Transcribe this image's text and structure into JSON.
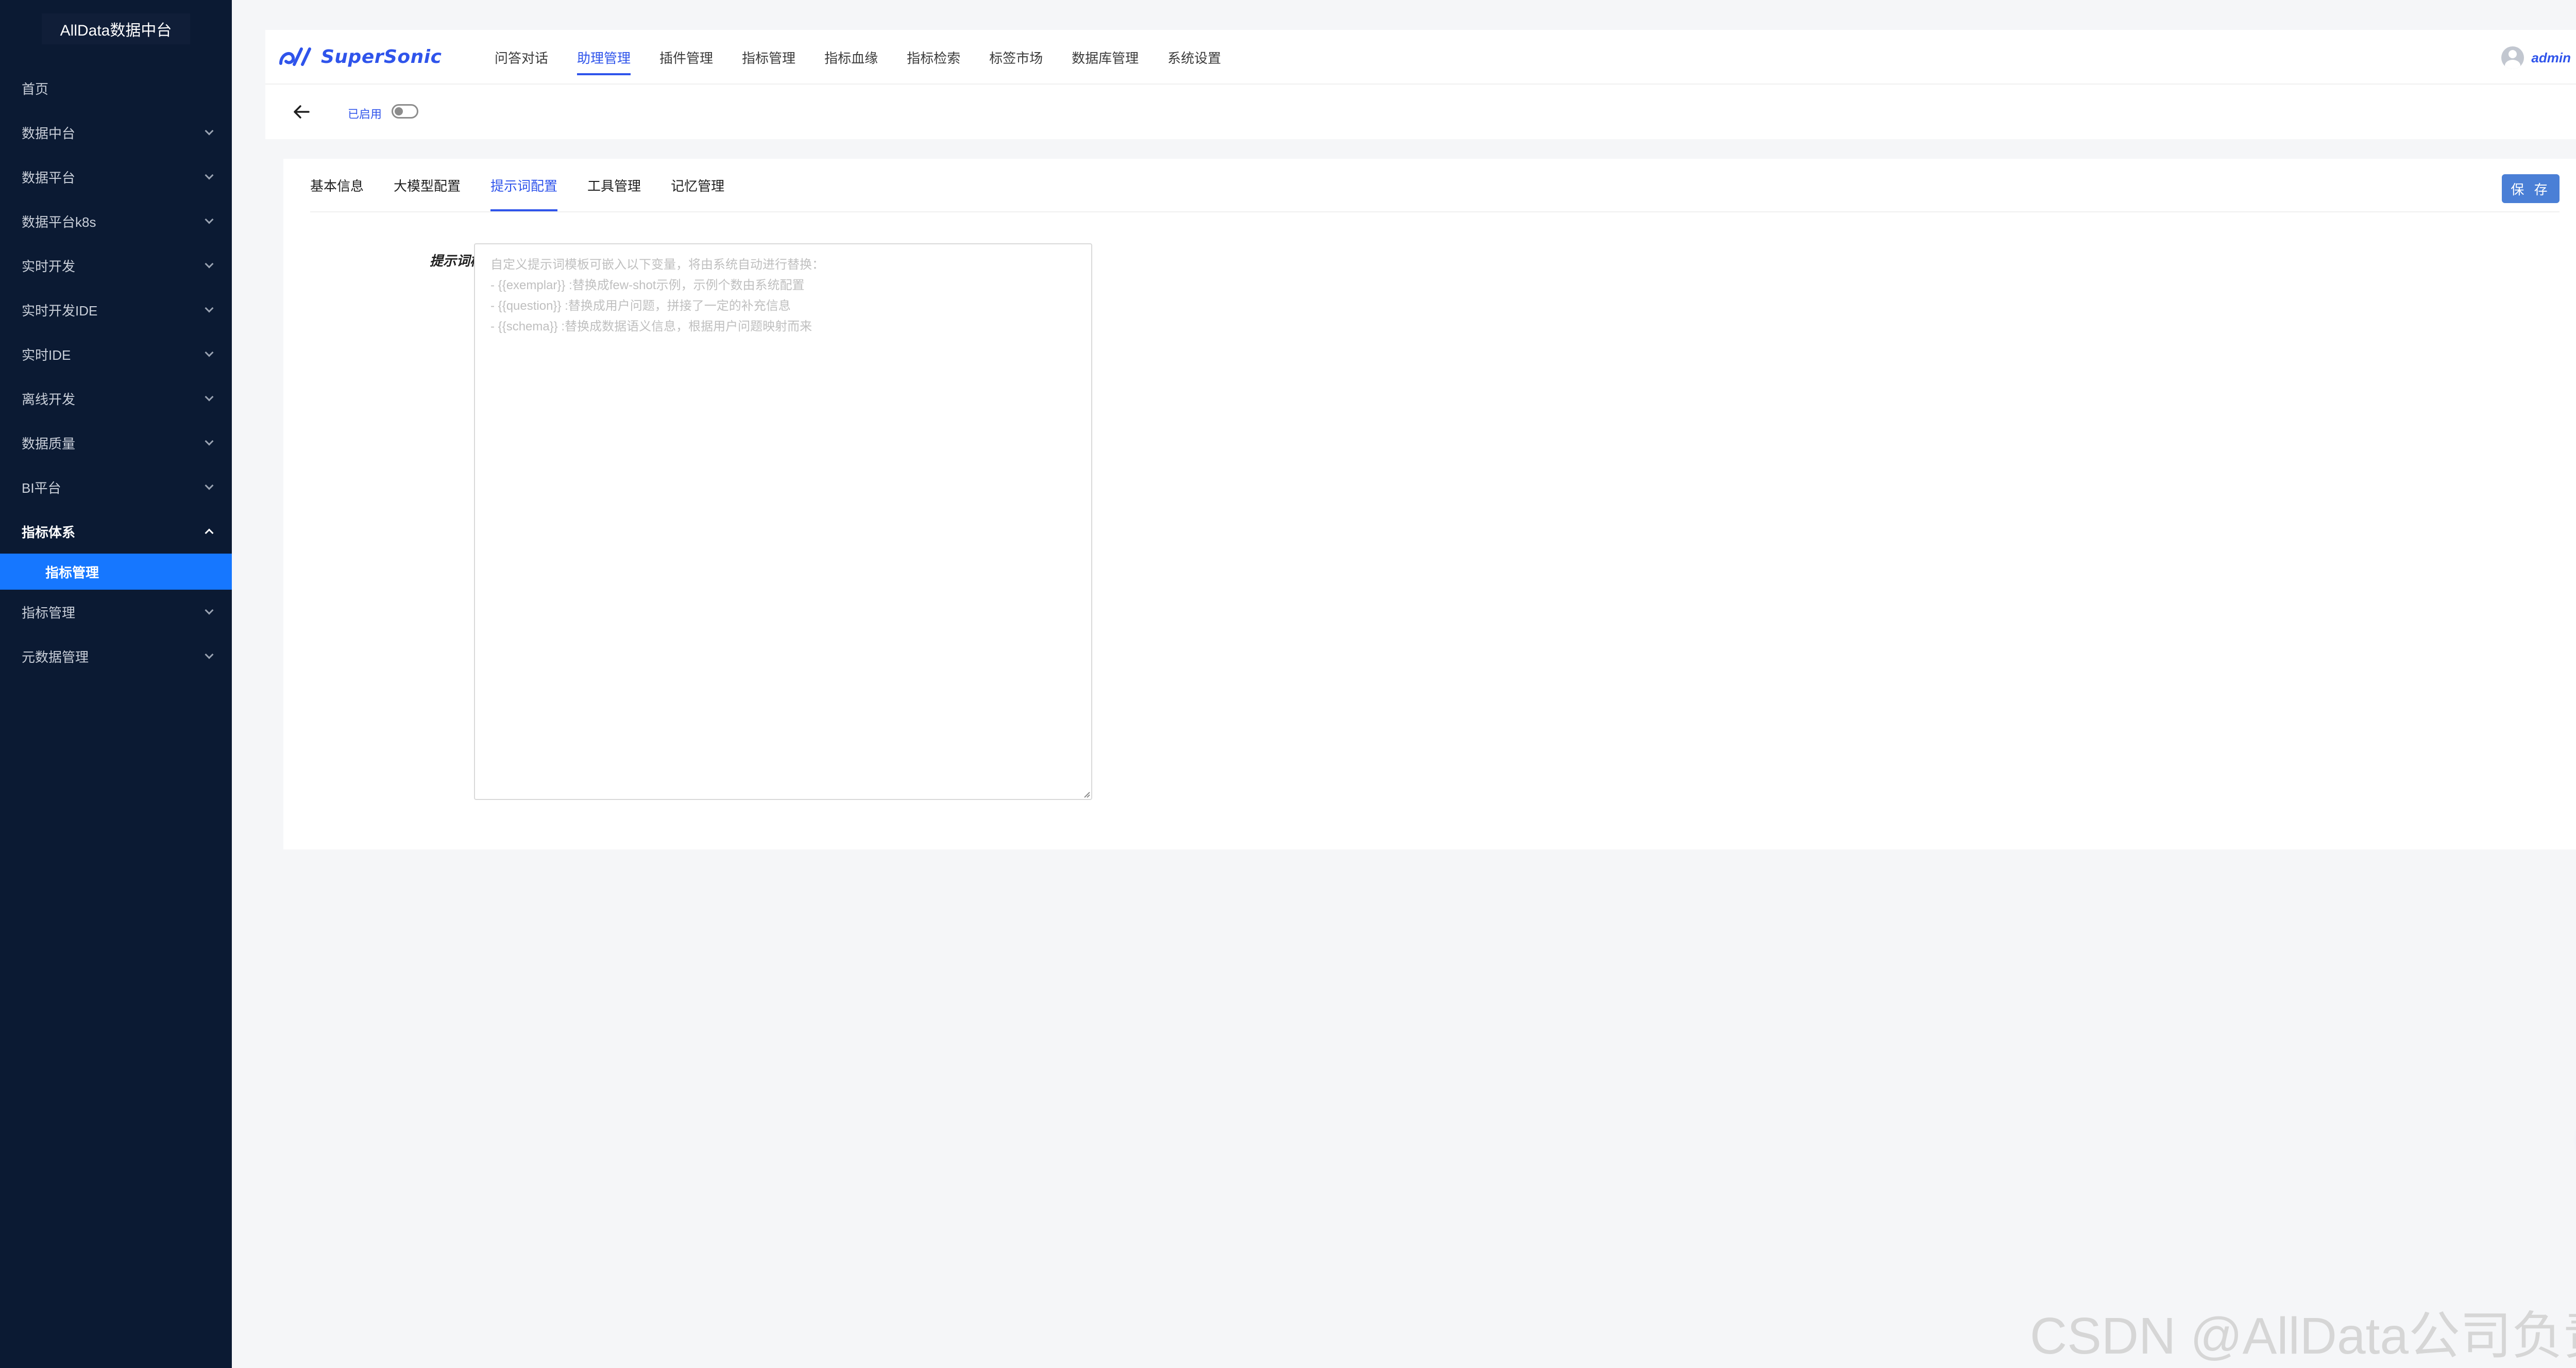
{
  "sidebar": {
    "brand": "AllData数据中台",
    "items": [
      {
        "label": "首页",
        "has_arrow": false
      },
      {
        "label": "数据中台",
        "has_arrow": true
      },
      {
        "label": "数据平台",
        "has_arrow": true
      },
      {
        "label": "数据平台k8s",
        "has_arrow": true
      },
      {
        "label": "实时开发",
        "has_arrow": true
      },
      {
        "label": "实时开发IDE",
        "has_arrow": true
      },
      {
        "label": "实时IDE",
        "has_arrow": true
      },
      {
        "label": "离线开发",
        "has_arrow": true
      },
      {
        "label": "数据质量",
        "has_arrow": true
      },
      {
        "label": "BI平台",
        "has_arrow": true
      },
      {
        "label": "指标体系",
        "has_arrow": true,
        "open": true
      },
      {
        "label": "指标管理",
        "has_arrow": true
      },
      {
        "label": "元数据管理",
        "has_arrow": true
      }
    ],
    "active_subitem": "指标管理"
  },
  "topnav": {
    "logo_text": "SuperSonic",
    "tabs": [
      "问答对话",
      "助理管理",
      "插件管理",
      "指标管理",
      "指标血缘",
      "指标检索",
      "标签市场",
      "数据库管理",
      "系统设置"
    ],
    "active_tab": "助理管理",
    "user": "admin"
  },
  "subheader": {
    "status_label": "已启用",
    "enabled": false
  },
  "card": {
    "tabs": [
      "基本信息",
      "大模型配置",
      "提示词配置",
      "工具管理",
      "记忆管理"
    ],
    "active_tab": "提示词配置",
    "save_label": "保 存",
    "form": {
      "label": "提示词模板：",
      "placeholder_lines": [
        "自定义提示词模板可嵌入以下变量，将由系统自动进行替换：",
        "- {{exemplar}} :替换成few-shot示例，示例个数由系统配置",
        "- {{question}} :替换成用户问题，拼接了一定的补充信息",
        "- {{schema}} :替换成数据语义信息，根据用户问题映射而来"
      ]
    }
  },
  "watermark": "CSDN @AllData公司负责人",
  "colors": {
    "sidebar_bg": "#0b1a33",
    "accent": "#2f54eb",
    "sidebar_active": "#1677ff",
    "save_button": "#4a7fd6"
  }
}
